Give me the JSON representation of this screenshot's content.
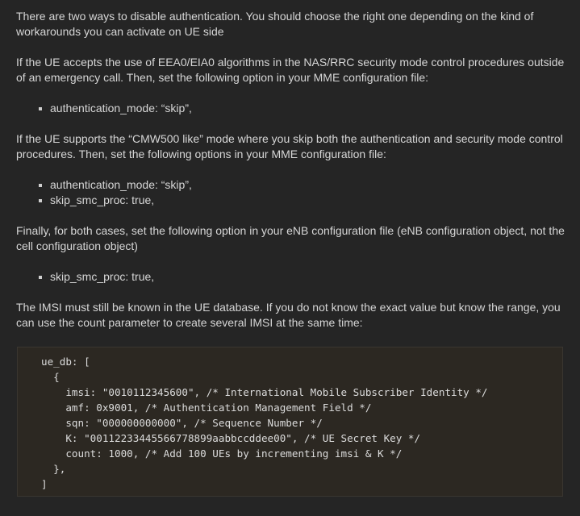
{
  "paragraphs": {
    "intro": "There are two ways to disable authentication. You should choose the right one depending on the kind of workarounds you can activate on UE side",
    "case1": "If the UE accepts the use of EEA0/EIA0 algorithms in the NAS/RRC security mode control procedures outside of an emergency call. Then, set the following option in your MME configuration file:",
    "case2": "If the UE supports the “CMW500 like” mode where you skip both the authentication and security mode control procedures. Then, set the following options in your MME configuration file:",
    "finally": "Finally, for both cases, set the following option in your eNB configuration file (eNB configuration object, not the cell configuration object)",
    "imsi": "The IMSI must still be known in the UE database. If you do not know the exact value but know the range, you can use the count parameter to create several IMSI at the same time:"
  },
  "lists": {
    "case1": [
      "authentication_mode: “skip”,"
    ],
    "case2": [
      "authentication_mode: “skip”,",
      "skip_smc_proc: true,"
    ],
    "enb": [
      "skip_smc_proc: true,"
    ]
  },
  "code_lines": [
    "ue_db: [",
    "  {",
    "    imsi: \"0010112345600\", /* International Mobile Subscriber Identity */",
    "    amf: 0x9001, /* Authentication Management Field */",
    "    sqn: \"000000000000\", /* Sequence Number */",
    "    K: \"00112233445566778899aabbccddee00\", /* UE Secret Key */",
    "    count: 1000, /* Add 100 UEs by incrementing imsi & K */",
    "  },",
    "]"
  ],
  "colors": {
    "background": "#252525",
    "text": "#d6d6d6",
    "code_background": "#2c2822"
  }
}
